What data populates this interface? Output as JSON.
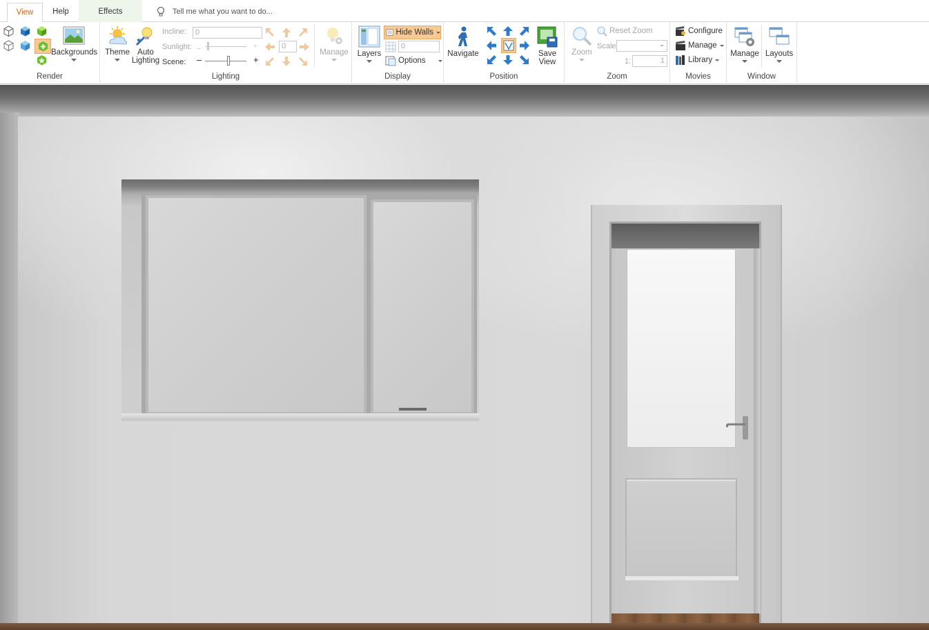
{
  "tabs": [
    {
      "label": "View",
      "active": true
    },
    {
      "label": "Help",
      "active": false
    },
    {
      "label": "Effects",
      "active": false
    }
  ],
  "tell_me": {
    "placeholder": "Tell me what you want to do..."
  },
  "ribbon": {
    "render": {
      "label": "Render",
      "backgrounds_label": "Backgrounds",
      "icons": [
        "wireframe-icon",
        "shaded-cube-icon",
        "green-cube-icon",
        "outline-cube-icon",
        "blue-cube-icon",
        "add-cube-icon",
        "star-cube-icon"
      ]
    },
    "lighting": {
      "label": "Lighting",
      "theme_label": "Theme",
      "auto_lighting_label": "Auto Lighting",
      "incline_label": "Incline:",
      "incline_value": "0",
      "sunlight_label": "Sunlight:",
      "scene_label": "Scene:",
      "sun_rotate_value": "0",
      "manage_label": "Manage"
    },
    "display": {
      "label": "Display",
      "layers_label": "Layers",
      "hide_walls_label": "Hide Walls",
      "grid_value": "0",
      "options_label": "Options"
    },
    "position": {
      "label": "Position",
      "navigate_label": "Navigate",
      "save_view_label": "Save View"
    },
    "zoom": {
      "label": "Zoom",
      "zoom_label": "Zoom",
      "reset_zoom_label": "Reset Zoom",
      "scale_label": "Scale:",
      "scale_ratio_prefix": "1:",
      "scale_ratio_value": "1"
    },
    "movies": {
      "label": "Movies",
      "configure_label": "Configure",
      "manage_label": "Manage",
      "library_label": "Library"
    },
    "window": {
      "label": "Window",
      "manage_label": "Manage",
      "layouts_label": "Layouts"
    }
  },
  "colors": {
    "accent": "#d1681c",
    "highlight": "#f7c995",
    "arrow_blue": "#2f7bc9",
    "arrow_orange": "#f0c9a0"
  }
}
